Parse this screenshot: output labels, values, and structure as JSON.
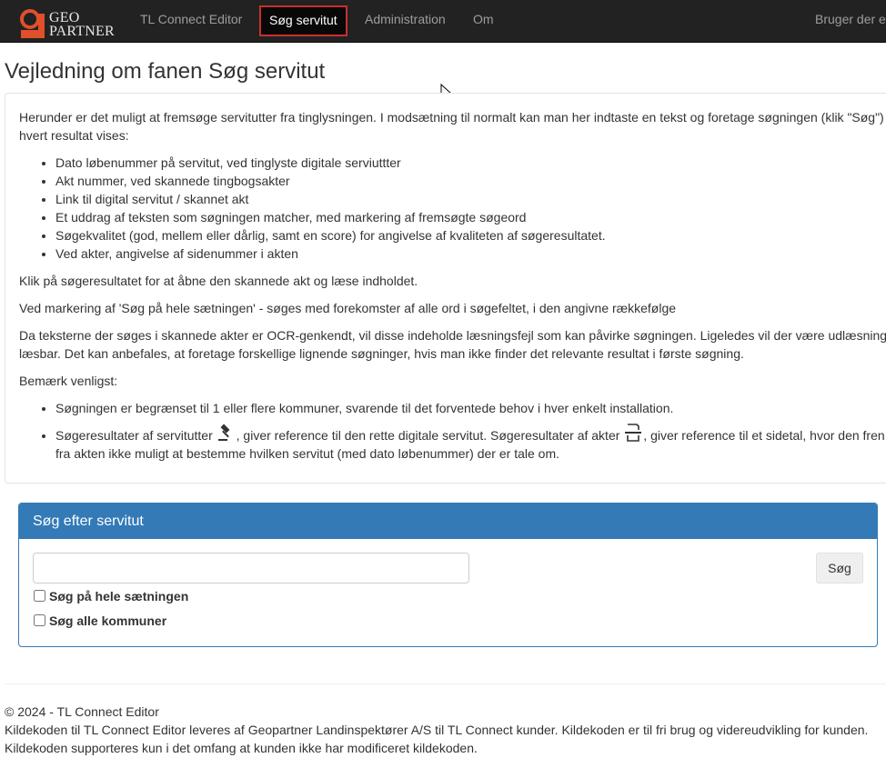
{
  "nav": {
    "logo_line1": "GEO",
    "logo_line2": "PARTNER",
    "items": [
      "TL Connect Editor",
      "Søg servitut",
      "Administration",
      "Om"
    ],
    "user": "Bruger der e"
  },
  "page_title": "Vejledning om fanen Søg servitut",
  "guide": {
    "intro": "Herunder er det muligt at fremsøge servitutter fra tinglysningen. I modsætning til normalt kan man her indtaste en tekst og foretage søgningen (klik \"Søg\") hvert resultat vises:",
    "bullets": [
      "Dato løbenummer på servitut, ved tinglyste digitale serviuttter",
      "Akt nummer, ved skannede tingbogsakter",
      "Link til digital servitut / skannet akt",
      "Et uddrag af teksten som søgningen matcher, med markering af fremsøgte søgeord",
      "Søgekvalitet (god, mellem eller dårlig, samt en score) for angivelse af kvaliteten af søgeresultatet.",
      "Ved akter, angivelse af sidenummer i akten"
    ],
    "p_click": "Klik på søgeresultatet for at åbne den skannede akt og læse indholdet.",
    "p_marking": "Ved markering af 'Søg på hele sætningen' - søges med forekomster af alle ord i søgefeltet, i den angivne rækkefølge",
    "p_ocr": "Da teksterne der søges i skannede akter er OCR-genkendt, vil disse indeholde læsningsfejl som kan påvirke søgningen. Ligeledes vil der være udlæsning læsbar. Det kan anbefales, at foretage forskellige lignende søgninger, hvis man ikke finder det relevante resultat i første søgning.",
    "note_label": "Bemærk venligst:",
    "note1": "Søgningen er begrænset til 1 eller flere kommuner, svarende til det forventede behov i hver enkelt installation.",
    "note2_a": "Søgeresultater af servitutter",
    "note2_b": ", giver reference til den rette digitale servitut. Søgeresultater af akter",
    "note2_c": ", giver reference til et sidetal, hvor den fren fra akten ikke muligt at bestemme hvilken servitut (med dato løbenummer) der er tale om."
  },
  "search_panel": {
    "heading": "Søg efter servitut",
    "input_value": "",
    "button": "Søg",
    "check_sentence": "Søg på hele sætningen",
    "check_all": "Søg alle kommuner"
  },
  "footer": {
    "copyright": "© 2024 - TL Connect Editor",
    "source": "Kildekoden til TL Connect Editor leveres af Geopartner Landinspektører A/S til TL Connect kunder. Kildekoden er til fri brug og videreudvikling for kunden. Kildekoden supporteres kun i det omfang at kunden ikke har modificeret kildekoden."
  },
  "colors": {
    "navbar": "#222222",
    "brand": "#e0502a",
    "active_border": "#c9302c",
    "panel": "#337ab7"
  },
  "icons": [
    "geopartner-logo-icon",
    "gavel-icon",
    "scanned-document-icon",
    "mouse-cursor-icon"
  ]
}
